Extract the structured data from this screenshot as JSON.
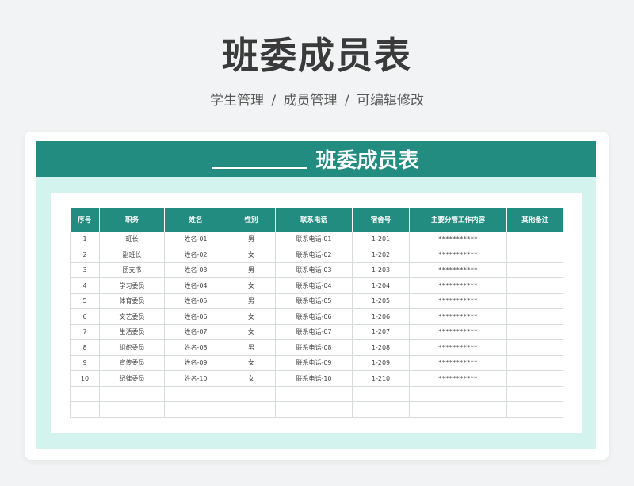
{
  "header": {
    "title": "班委成员表",
    "subtitle": "学生管理 /  成员管理  /  可编辑修改"
  },
  "sheet": {
    "banner_title": "班委成员表",
    "columns": [
      "序号",
      "职务",
      "姓名",
      "性别",
      "联系电话",
      "宿舍号",
      "主要分管工作内容",
      "其他备注"
    ],
    "rows": [
      [
        "1",
        "班长",
        "姓名-01",
        "男",
        "联系电话-01",
        "1-201",
        "***********",
        ""
      ],
      [
        "2",
        "副班长",
        "姓名-02",
        "女",
        "联系电话-02",
        "1-202",
        "***********",
        ""
      ],
      [
        "3",
        "团支书",
        "姓名-03",
        "男",
        "联系电话-03",
        "1-203",
        "***********",
        ""
      ],
      [
        "4",
        "学习委员",
        "姓名-04",
        "女",
        "联系电话-04",
        "1-204",
        "***********",
        ""
      ],
      [
        "5",
        "体育委员",
        "姓名-05",
        "男",
        "联系电话-05",
        "1-205",
        "***********",
        ""
      ],
      [
        "6",
        "文艺委员",
        "姓名-06",
        "女",
        "联系电话-06",
        "1-206",
        "***********",
        ""
      ],
      [
        "7",
        "生活委员",
        "姓名-07",
        "女",
        "联系电话-07",
        "1-207",
        "***********",
        ""
      ],
      [
        "8",
        "组织委员",
        "姓名-08",
        "男",
        "联系电话-08",
        "1-208",
        "***********",
        ""
      ],
      [
        "9",
        "宣传委员",
        "姓名-09",
        "女",
        "联系电话-09",
        "1-209",
        "***********",
        ""
      ],
      [
        "10",
        "纪律委员",
        "姓名-10",
        "女",
        "联系电话-10",
        "1-210",
        "***********",
        ""
      ],
      [
        "",
        "",
        "",
        "",
        "",
        "",
        "",
        ""
      ],
      [
        "",
        "",
        "",
        "",
        "",
        "",
        "",
        ""
      ]
    ]
  },
  "colors": {
    "accent": "#228c81",
    "sheet_background": "#d3f3ef",
    "page_background": "#f1f3f4"
  }
}
